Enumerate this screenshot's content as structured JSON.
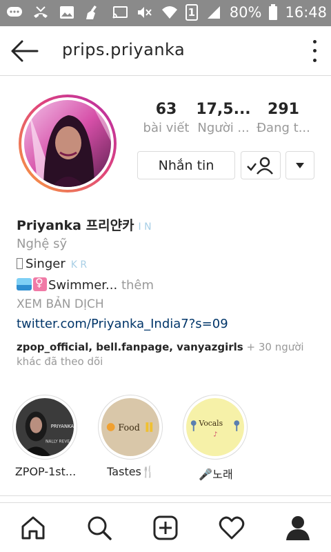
{
  "status_bar": {
    "battery": "80%",
    "time": "16:48",
    "sim": "1"
  },
  "header": {
    "username": "prips.priyanka"
  },
  "stats": [
    {
      "value": "63",
      "label": "bài viết"
    },
    {
      "value": "17,5...",
      "label": "Người ..."
    },
    {
      "value": "291",
      "label": "Đang t..."
    }
  ],
  "buttons": {
    "message": "Nhắn tin"
  },
  "bio": {
    "name": "Priyanka 프리얀카",
    "name_suffix": "I  N",
    "category": "Nghệ sỹ",
    "line1": "Singer",
    "line1_suffix": "K  R",
    "line2": "Swimmer...",
    "line2_more": " thêm",
    "translate": "XEM BẢN DỊCH",
    "link": "twitter.com/Priyanka_India7?s=09",
    "followed_by_users": "zpop_official, bell.fanpage, vanyazgirls",
    "followed_by_rest": " + 30 người khác đã theo dõi"
  },
  "highlights": [
    {
      "label": "ZPOP-1st...",
      "thumb_text": "PRIYANKA",
      "thumb_sub": "NALLY REVE"
    },
    {
      "label": "Tastes🍴",
      "thumb_text": "Food"
    },
    {
      "label": "🎤노래",
      "thumb_text": "Vocals"
    }
  ],
  "colors": {
    "text": "#262626",
    "muted": "#999999",
    "link": "#003569",
    "border": "#dbdbdb",
    "status_bar": "#8a8a8a"
  },
  "icons": {
    "nav": [
      "home-icon",
      "search-icon",
      "add-icon",
      "heart-icon",
      "profile-icon"
    ]
  }
}
